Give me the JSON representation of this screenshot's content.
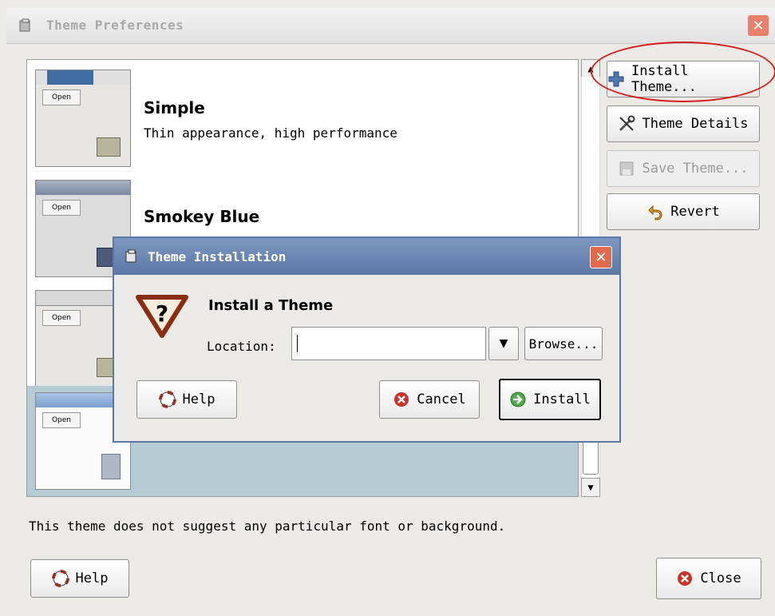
{
  "window": {
    "title": "Theme Preferences"
  },
  "themes": [
    {
      "name": "Simple",
      "description": "Thin appearance, high performance",
      "preview_button": "Open",
      "selected": false
    },
    {
      "name": "Smokey Blue",
      "description": "",
      "preview_button": "Open",
      "selected": false
    },
    {
      "name": "",
      "description": "",
      "preview_button": "Open",
      "selected": false
    },
    {
      "name": "",
      "description": "",
      "preview_button": "Open",
      "selected": true
    }
  ],
  "side_buttons": {
    "install_theme": "Install Theme...",
    "theme_details": "Theme Details",
    "save_theme": "Save Theme...",
    "revert": "Revert"
  },
  "footer": {
    "message": "This theme does not suggest any particular font or background.",
    "help_label": "Help",
    "close_label": "Close"
  },
  "dialog": {
    "title": "Theme Installation",
    "heading": "Install a Theme",
    "location_label": "Location:",
    "location_value": "",
    "browse_label": "Browse...",
    "help_label": "Help",
    "cancel_label": "Cancel",
    "install_label": "Install"
  },
  "colors": {
    "selection": "#b6ccd4",
    "dialog_title": "#5a77a6",
    "annotation_circle": "#d41f1f",
    "close_button": "#e8806c"
  }
}
